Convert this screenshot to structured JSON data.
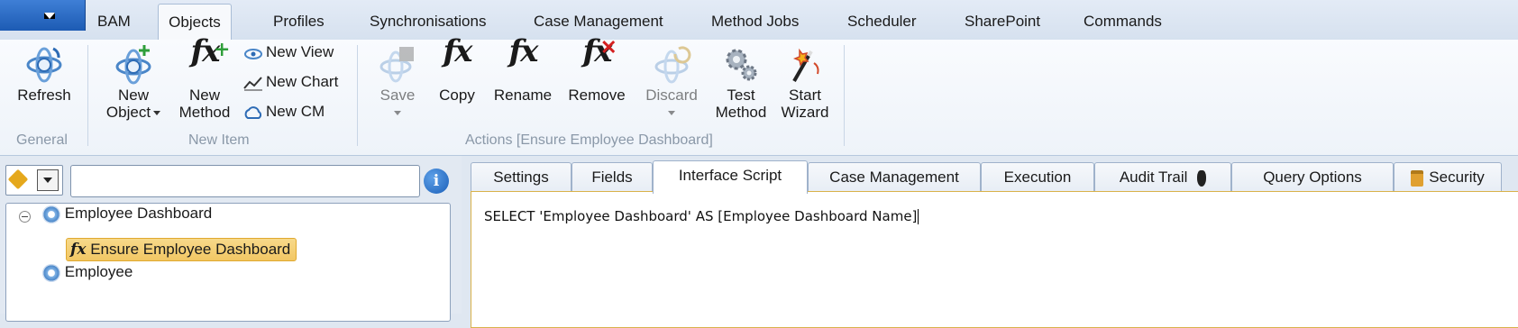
{
  "menu_tabs": [
    "BAM",
    "Objects",
    "Profiles",
    "Synchronisations",
    "Case Management",
    "Method Jobs",
    "Scheduler",
    "SharePoint",
    "Commands"
  ],
  "active_menu_tab": "Objects",
  "ribbon": {
    "refresh": "Refresh",
    "new_object_1": "New",
    "new_object_2": "Object",
    "new_method_1": "New",
    "new_method_2": "Method",
    "new_view": "New View",
    "new_chart": "New Chart",
    "new_cm": "New CM",
    "save": "Save",
    "copy": "Copy",
    "rename": "Rename",
    "remove": "Remove",
    "discard": "Discard",
    "test_method_1": "Test",
    "test_method_2": "Method",
    "start_wizard_1": "Start",
    "start_wizard_2": "Wizard",
    "group_general": "General",
    "group_new_item": "New Item",
    "group_actions": "Actions [Ensure Employee Dashboard]"
  },
  "search": {
    "value": "",
    "placeholder": ""
  },
  "tree": {
    "root": "Employee Dashboard",
    "child_selected": "Ensure Employee Dashboard",
    "sibling": "Employee"
  },
  "content_tabs": [
    "Settings",
    "Fields",
    "Interface Script",
    "Case Management",
    "Execution",
    "Audit Trail",
    "Query Options",
    "Security"
  ],
  "active_content_tab": "Interface Script",
  "script_text": "SELECT 'Employee Dashboard' AS [Employee Dashboard Name]",
  "colors": {
    "accent": "#1d5bb4",
    "selection": "#f2c764",
    "editor_border": "#d9b24a"
  }
}
